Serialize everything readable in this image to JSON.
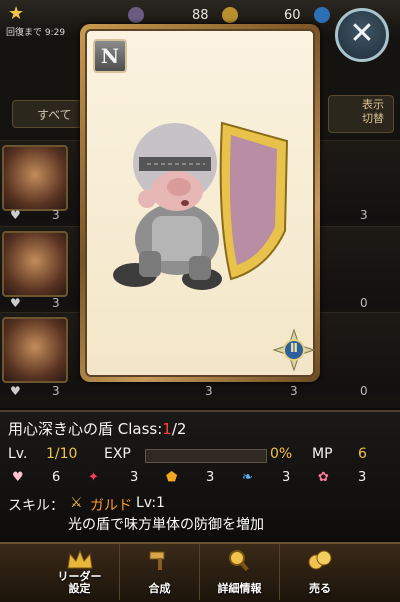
{
  "topbar": {
    "recover_text": "回復まで 9:29",
    "stat1": "88",
    "stat2": "60"
  },
  "background_list": {
    "filter_tab": "すべて",
    "display_toggle": [
      "表示",
      "切替"
    ],
    "row_values": [
      "3",
      "3",
      "3",
      "0",
      "3",
      "0",
      "3",
      "3"
    ]
  },
  "card": {
    "rarity": "N",
    "class_badge": "Ⅱ"
  },
  "info": {
    "title_prefix": "用心深き心の盾 Class:",
    "class_current": "1",
    "class_max": "/2",
    "lv_label": "Lv.",
    "lv_value": "1/10",
    "exp_label": "EXP",
    "exp_value": "0%",
    "mp_label": "MP",
    "mp_value": "6",
    "stats": [
      "6",
      "3",
      "3",
      "3",
      "3"
    ],
    "skill_label": "スキル：",
    "skill_name": "ガルド",
    "skill_level": "Lv:1",
    "skill_desc": "光の盾で味方単体の防御を増加"
  },
  "menu": {
    "leader": [
      "リーダー",
      "設定"
    ],
    "fuse": "合成",
    "details": "詳細情報",
    "sell": "売る"
  },
  "colors": {
    "accent_gold": "#f1c24e",
    "class_red": "#ff3b3b",
    "skill_orange": "#ff9a2e"
  }
}
